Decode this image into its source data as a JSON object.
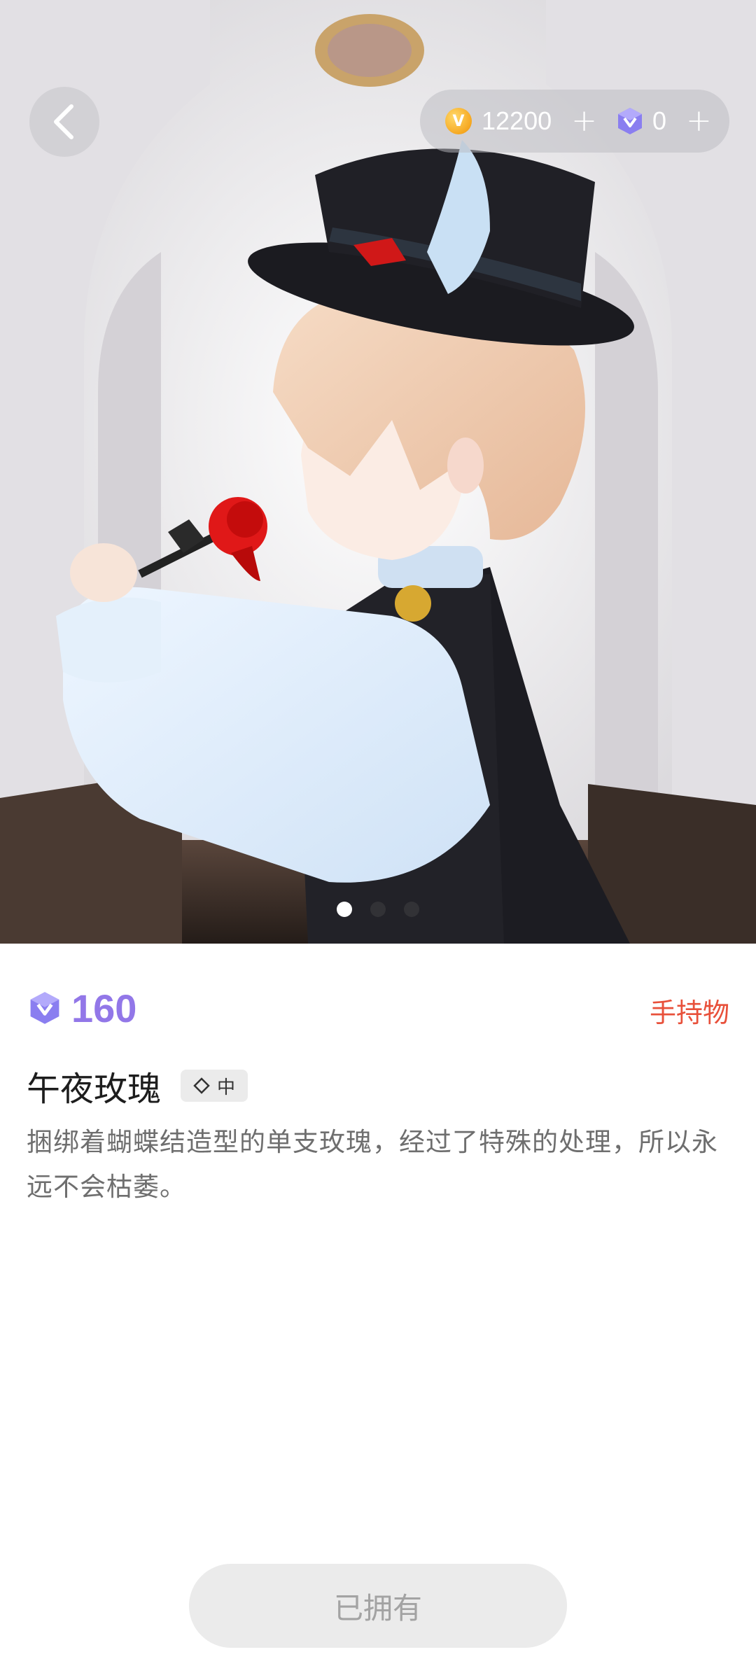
{
  "header": {
    "back_icon": "chevron-left-icon",
    "coins": {
      "icon": "coin-icon",
      "value": "12200",
      "add": "+"
    },
    "gems": {
      "icon": "gem-icon",
      "value": "0",
      "add": "+"
    }
  },
  "gallery": {
    "pages": 3,
    "active_page": 1
  },
  "item": {
    "price_icon": "gem-icon",
    "price": "160",
    "category": "手持物",
    "name": "午夜玫瑰",
    "rarity_icon": "diamond-outline-icon",
    "rarity": "中",
    "description": "捆绑着蝴蝶结造型的单支玫瑰，经过了特殊的处理，所以永远不会枯萎。"
  },
  "footer": {
    "button_label": "已拥有"
  },
  "colors": {
    "price": "#9277e8",
    "category": "#e8503a",
    "gem": "#8a7ef0",
    "coin": "#f6a821",
    "button_bg": "#ebebeb",
    "button_text": "#a3a3a3"
  }
}
